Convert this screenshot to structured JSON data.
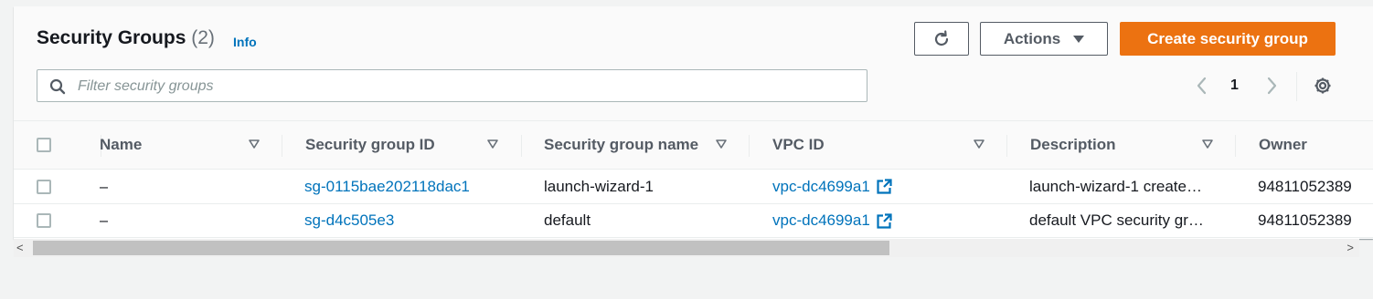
{
  "header": {
    "title": "Security Groups",
    "count": "(2)",
    "info_label": "Info",
    "actions_label": "Actions",
    "create_label": "Create security group"
  },
  "search": {
    "placeholder": "Filter security groups",
    "value": ""
  },
  "pagination": {
    "current_page": "1"
  },
  "table": {
    "columns": [
      "Name",
      "Security group ID",
      "Security group name",
      "VPC ID",
      "Description",
      "Owner"
    ],
    "rows": [
      {
        "name": "–",
        "sg_id": "sg-0115bae202118dac1",
        "sg_name": "launch-wizard-1",
        "vpc_id": "vpc-dc4699a1",
        "description": "launch-wizard-1 create…",
        "owner": "94811052389"
      },
      {
        "name": "–",
        "sg_id": "sg-d4c505e3",
        "sg_name": "default",
        "vpc_id": "vpc-dc4699a1",
        "description": "default VPC security gr…",
        "owner": "94811052389"
      }
    ]
  },
  "colors": {
    "accent": "#ec7211",
    "link": "#0073bb",
    "text": "#16191f"
  },
  "icons": [
    "refresh-icon",
    "caret-down-icon",
    "search-icon",
    "chevron-left-icon",
    "chevron-right-icon",
    "gear-icon",
    "sort-icon",
    "external-link-icon"
  ]
}
